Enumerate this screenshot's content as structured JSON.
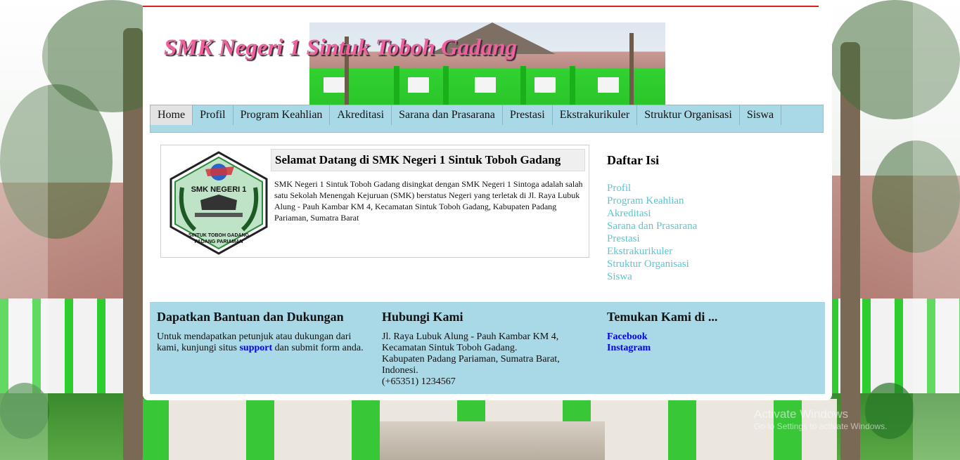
{
  "header": {
    "site_title": "SMK Negeri 1 Sintuk Toboh Gadang"
  },
  "nav": {
    "items": [
      {
        "label": "Home",
        "active": true
      },
      {
        "label": "Profil"
      },
      {
        "label": "Program Keahlian"
      },
      {
        "label": "Akreditasi"
      },
      {
        "label": "Sarana dan Prasarana"
      },
      {
        "label": "Prestasi"
      },
      {
        "label": "Ekstrakurikuler"
      },
      {
        "label": "Struktur Organisasi"
      },
      {
        "label": "Siswa"
      }
    ]
  },
  "welcome": {
    "title": "Selamat Datang di SMK Negeri 1 Sintuk Toboh Gadang",
    "text": "SMK Negeri 1 Sintuk Toboh Gadang disingkat dengan SMK Negeri 1 Sintoga adalah salah satu Sekolah Menengah Kejuruan (SMK) berstatus Negeri yang terletak di Jl. Raya Lubuk Alung - Pauh Kambar KM 4, Kecamatan Sintuk Toboh Gadang, Kabupaten Padang Pariaman, Sumatra Barat",
    "logo": {
      "top_text": "SMK NEGERI 1",
      "bottom_text_1": "SINTUK TOBOH GADANG",
      "bottom_text_2": "PADANG PARIAMAN"
    }
  },
  "sidebar": {
    "title": "Daftar Isi",
    "links": [
      "Profil",
      "Program Keahlian",
      "Akreditasi",
      "Sarana dan Prasarana",
      "Prestasi",
      "Ekstrakurikuler",
      "Struktur Organisasi",
      "Siswa"
    ]
  },
  "footer": {
    "help": {
      "title": "Dapatkan Bantuan dan Dukungan",
      "text_before": "Untuk mendapatkan petunjuk atau dukungan dari kami, kunjungi situs ",
      "link": "support",
      "text_after": " dan submit form anda."
    },
    "contact": {
      "title": "Hubungi Kami",
      "lines": [
        "Jl. Raya Lubuk Alung - Pauh Kambar KM 4,",
        "Kecamatan Sintuk Toboh Gadang.",
        "Kabupaten Padang Pariaman, Sumatra Barat,",
        "Indonesi.",
        "(+65351) 1234567"
      ]
    },
    "social": {
      "title": "Temukan Kami di ...",
      "links": [
        "Facebook",
        "Instagram"
      ]
    }
  },
  "watermark": {
    "line1": "Activate Windows",
    "line2": "Go to Settings to activate Windows."
  },
  "colors": {
    "accent_line": "#d92020",
    "nav_bg": "#a9d8e6",
    "sidebar_link": "#58c7d2",
    "title_pink": "#f0609f"
  }
}
